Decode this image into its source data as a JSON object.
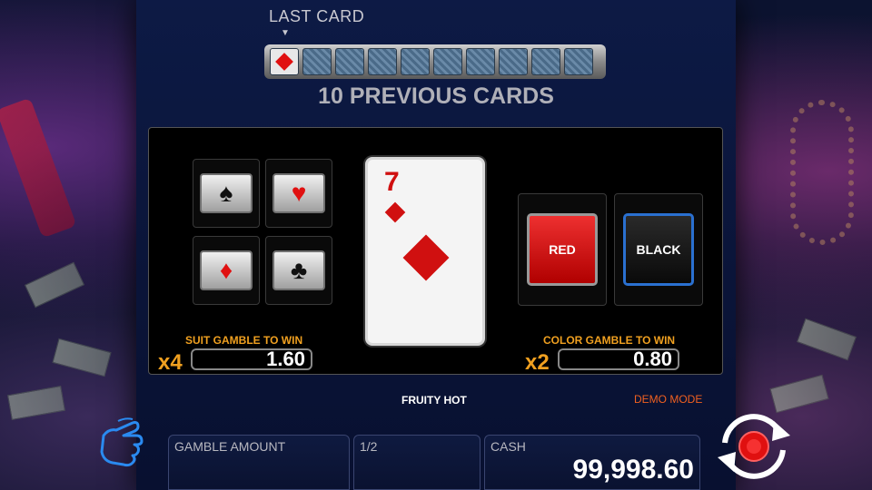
{
  "header": {
    "last_card_label": "LAST CARD",
    "previous_cards_label": "10 PREVIOUS CARDS",
    "history": [
      "diamond",
      "back",
      "back",
      "back",
      "back",
      "back",
      "back",
      "back",
      "back",
      "back"
    ]
  },
  "suit_gamble": {
    "suits": [
      {
        "name": "spade",
        "symbol": "♠",
        "color": "black"
      },
      {
        "name": "heart",
        "symbol": "♥",
        "color": "red"
      },
      {
        "name": "diamond",
        "symbol": "♦",
        "color": "red"
      },
      {
        "name": "club",
        "symbol": "♣",
        "color": "black"
      }
    ],
    "label": "SUIT GAMBLE TO WIN",
    "multiplier": "x4",
    "value": "1.60"
  },
  "current_card": {
    "rank": "7",
    "suit": "diamond",
    "color": "#d01010"
  },
  "color_gamble": {
    "red_label": "RED",
    "black_label": "BLACK",
    "label": "COLOR GAMBLE TO WIN",
    "multiplier": "x2",
    "value": "0.80"
  },
  "footer": {
    "game_name": "FRUITY HOT",
    "mode": "DEMO MODE",
    "gamble_amount_label": "GAMBLE AMOUNT",
    "fraction_label": "1/2",
    "cash_label": "CASH",
    "cash_value": "99,998.60"
  },
  "colors": {
    "accent_orange": "#f0a020",
    "demo_orange": "#f06020",
    "panel_blue": "#0d1a45",
    "spin_red": "#e01010",
    "hand_blue": "#2a8af0"
  }
}
